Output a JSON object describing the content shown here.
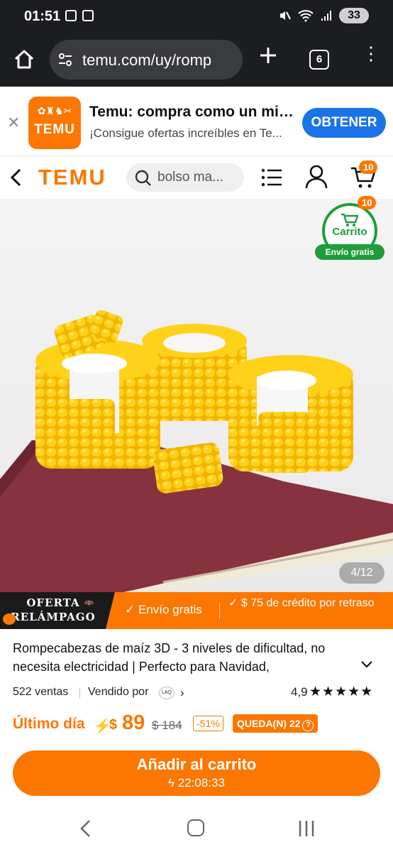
{
  "status": {
    "time": "01:51",
    "battery": "33"
  },
  "browser": {
    "url": "temu.com/uy/romp",
    "tab_count": "6"
  },
  "banner": {
    "logo_text": "TEMU",
    "title": "Temu: compra como un mil...",
    "subtitle": "¡Consigue ofertas increíbles en Te...",
    "get_label": "OBTENER"
  },
  "header": {
    "brand": "TEMU",
    "search_placeholder": "bolso ma...",
    "cart_count": "10"
  },
  "floating_cart": {
    "label": "Carrito",
    "shipping": "Envío gratis",
    "count": "10"
  },
  "gallery": {
    "counter": "4/12"
  },
  "flash": {
    "title_line1": "OFERTA",
    "title_line2": "RELÁMPAGO",
    "free_shipping": "✓ Envío gratis",
    "credit": "✓ $ 75 de crédito por retraso"
  },
  "product": {
    "title": "Rompecabezas de maíz 3D - 3 niveles de dificultad, no necesita electricidad | Perfecto para Navidad,",
    "sales": "522 ventas",
    "sold_by": "Vendido por",
    "seller_logo": "LAQ",
    "rating": "4,9",
    "stars": "★★★★★",
    "last_day": "Último día",
    "currency": "$",
    "price": "89",
    "old_price": "$ 184",
    "discount": "-51%",
    "remaining": "QUEDA(N) 22"
  },
  "cta": {
    "label": "Añadir al carrito",
    "timer": "22:08:33"
  },
  "colors": {
    "brand": "#fb7701",
    "green": "#1f9d3a",
    "blue": "#1a73e8"
  }
}
